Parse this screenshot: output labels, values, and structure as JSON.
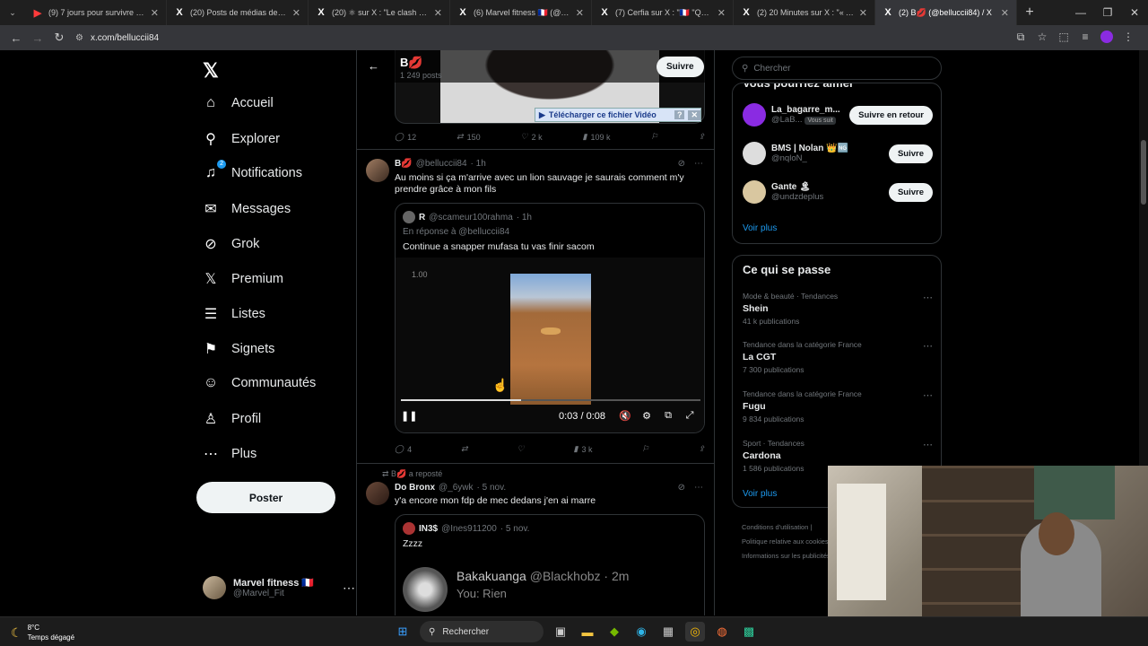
{
  "browser": {
    "tabs": [
      {
        "icon": "youtube-icon",
        "title": "(9) 7 jours pour survivre en Jun..."
      },
      {
        "icon": "x-icon",
        "title": "(20) Posts de médias de BMS | N..."
      },
      {
        "icon": "x-icon",
        "title": "(20) ⚛ sur X : \"Le clash booba..."
      },
      {
        "icon": "x-icon",
        "title": "(6) Marvel fitness 🇫🇷 (@Marvel_..."
      },
      {
        "icon": "x-icon",
        "title": "(7) Cerfia sur X : \"🇫🇷 \"Quand ..."
      },
      {
        "icon": "x-icon",
        "title": "(2) 20 Minutes sur X : \"« Avec l..."
      },
      {
        "icon": "x-icon",
        "title": "(2) B💋 (@belluccii84) / X"
      }
    ],
    "url": "x.com/belluccii84"
  },
  "sidebar": {
    "items": [
      {
        "label": "Accueil",
        "icon": "home-icon"
      },
      {
        "label": "Explorer",
        "icon": "search-icon"
      },
      {
        "label": "Notifications",
        "icon": "bell-icon",
        "badge": "2"
      },
      {
        "label": "Messages",
        "icon": "mail-icon"
      },
      {
        "label": "Grok",
        "icon": "grok-icon"
      },
      {
        "label": "Premium",
        "icon": "x-logo-icon"
      },
      {
        "label": "Listes",
        "icon": "list-icon"
      },
      {
        "label": "Signets",
        "icon": "bookmark-icon"
      },
      {
        "label": "Communautés",
        "icon": "people-icon"
      },
      {
        "label": "Profil",
        "icon": "person-icon"
      },
      {
        "label": "Plus",
        "icon": "more-circle-icon"
      }
    ],
    "post_label": "Poster",
    "account": {
      "name": "Marvel fitness 🇫🇷",
      "handle": "@Marvel_Fit"
    }
  },
  "profile_header": {
    "name": "B💋",
    "posts": "1 249 posts",
    "follow_label": "Suivre"
  },
  "feed": {
    "download_bar": "Télécharger ce fichier Vidéo",
    "tweet0_actions": {
      "replies": "12",
      "reposts": "150",
      "likes": "2 k",
      "views": "109 k"
    },
    "tweet1": {
      "name": "B💋",
      "handle": "@belluccii84",
      "time": "· 1h",
      "text": "Au moins si ça m'arrive avec un lion sauvage je saurais comment m'y prendre grâce à mon fils",
      "quote": {
        "name": "R",
        "handle": "@scameur100rahma",
        "time": "· 1h",
        "reply_to": "En réponse à @belluccii84",
        "text": "Continue a snapper mufasa tu vas finir sacom"
      },
      "video": {
        "tag": "1.00",
        "time": "0:03 / 0:08",
        "progress": 0.4
      },
      "actions": {
        "replies": "4",
        "reposts": "",
        "likes": "",
        "views": "3 k"
      }
    },
    "repost_label": "B💋 a reposté",
    "tweet2": {
      "name": "Do Bronx",
      "handle": "@_6ywk",
      "time": "· 5 nov.",
      "text": "y'a encore mon fdp de mec dedans j'en ai marre",
      "quote": {
        "name": "IN3$",
        "handle": "@Ines911200",
        "time": "· 5 nov.",
        "text": "Zzzz",
        "snap_name": "Bakakuanga",
        "snap_handle": "@Blackhobz · 2m",
        "snap_sub": "You: Rien"
      }
    }
  },
  "right": {
    "search_placeholder": "Chercher",
    "who_title": "Vous pourriez aimer",
    "who": [
      {
        "name": "La_bagarre_m...",
        "handle": "@LaB...",
        "tag": "Vous suit",
        "button": "Suivre en retour"
      },
      {
        "name": "BMS | Nolan 👑🆖",
        "handle": "@nqloN_",
        "tag": "",
        "button": "Suivre"
      },
      {
        "name": "Gante 🏝",
        "handle": "@undzdeplus",
        "tag": "",
        "button": "Suivre"
      }
    ],
    "voir_plus": "Voir plus",
    "trends_title": "Ce qui se passe",
    "trends": [
      {
        "category": "Mode & beauté · Tendances",
        "name": "Shein",
        "posts": "41 k publications"
      },
      {
        "category": "Tendance dans la catégorie France",
        "name": "La CGT",
        "posts": "7 300 publications"
      },
      {
        "category": "Tendance dans la catégorie France",
        "name": "Fugu",
        "posts": "9 834 publications"
      },
      {
        "category": "Sport · Tendances",
        "name": "Cardona",
        "posts": "1 586 publications"
      }
    ],
    "footer": [
      "Conditions d'utilisation |",
      "Politique relative aux cookies",
      "Informations sur les publicités"
    ]
  },
  "taskbar": {
    "temp": "8°C",
    "weather": "Temps dégagé",
    "search": "Rechercher"
  },
  "colors": {
    "accent": "#1d9bf0",
    "background": "#000000",
    "border": "#2f3336"
  }
}
